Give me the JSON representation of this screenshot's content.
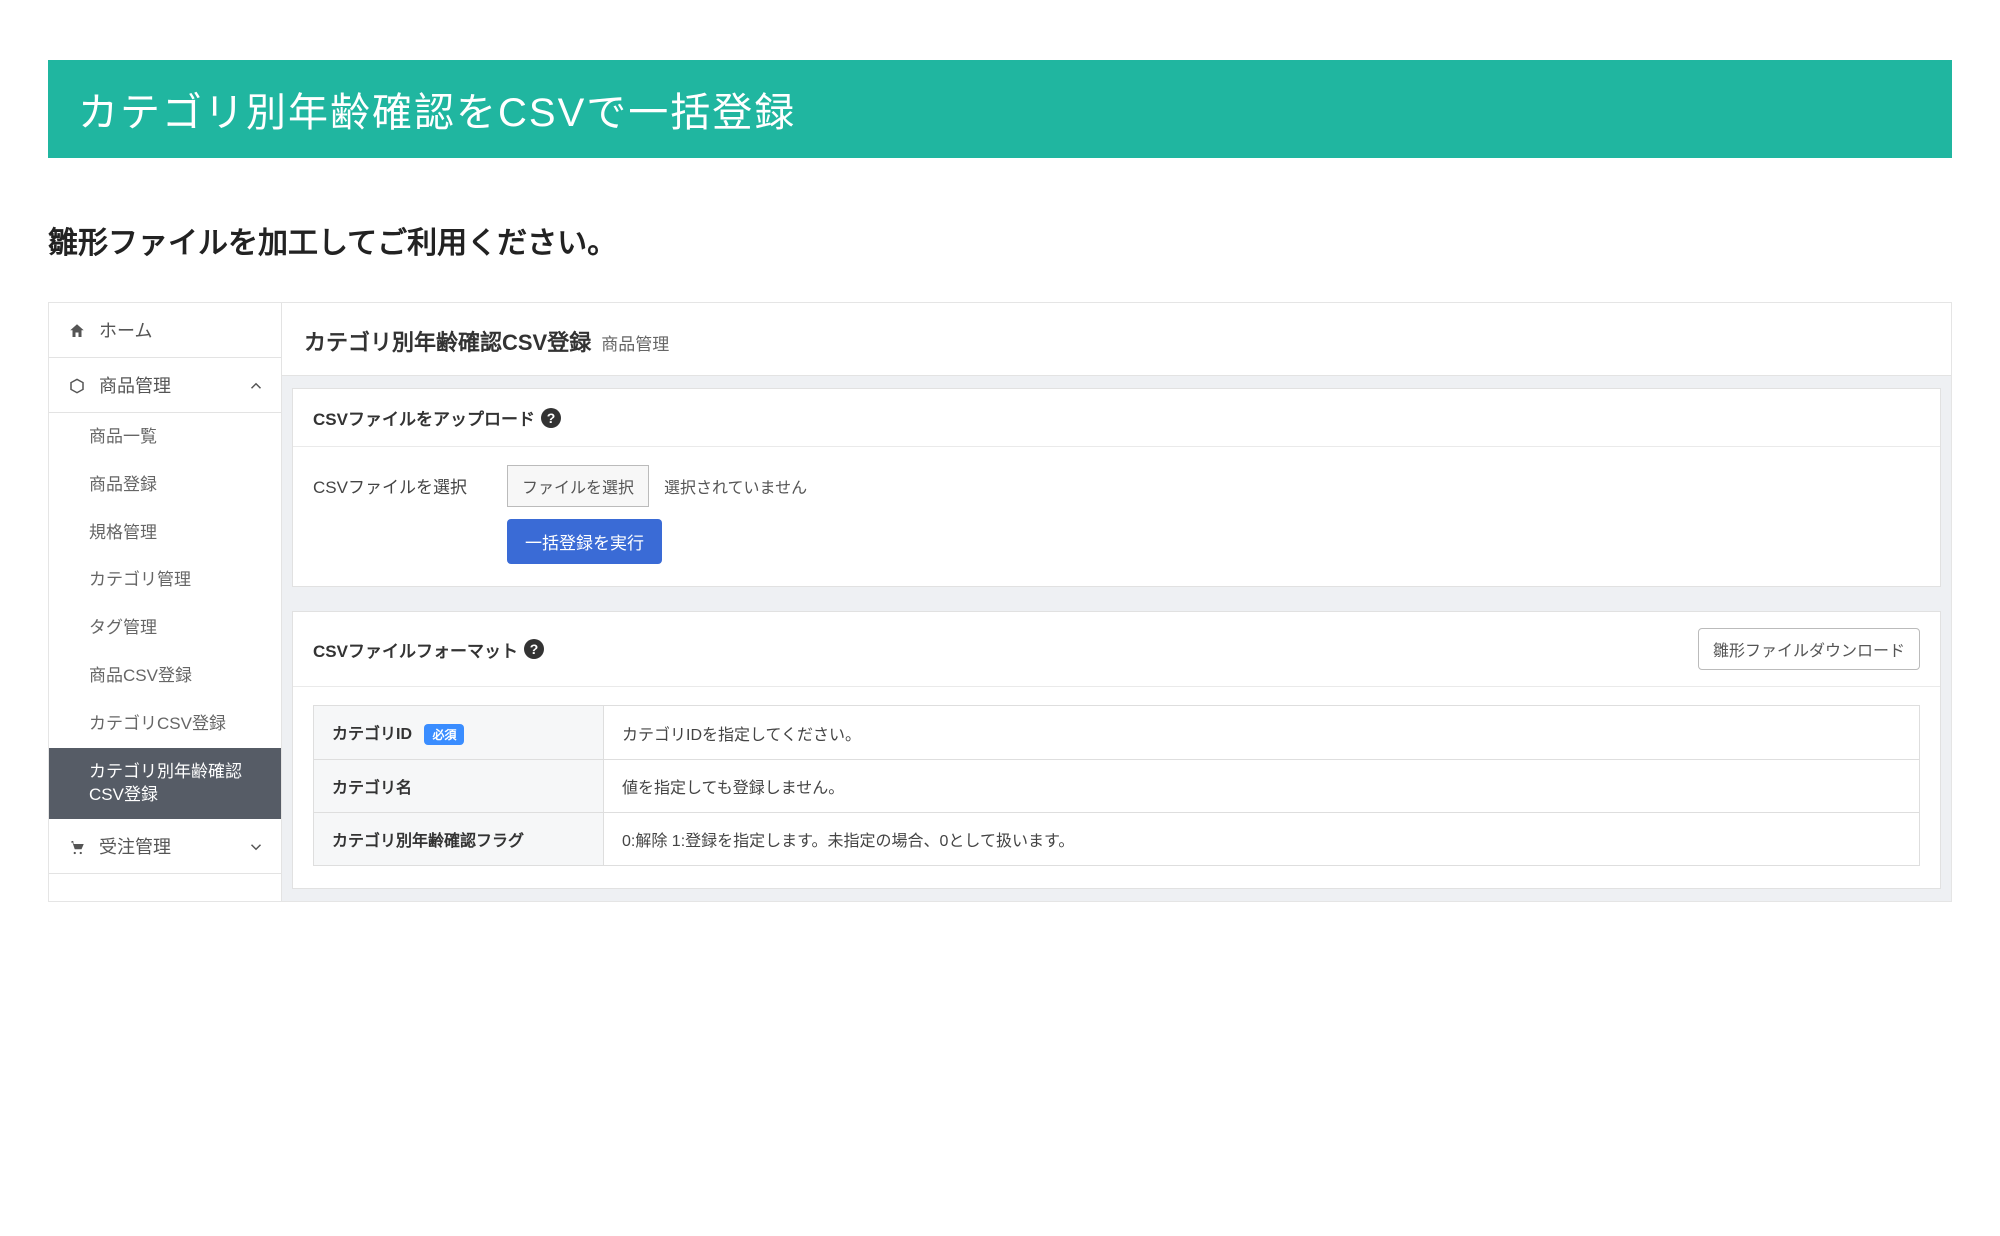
{
  "banner": {
    "title": "カテゴリ別年齢確認をCSVで一括登録"
  },
  "intro": "雛形ファイルを加工してご利用ください。",
  "sidebar": {
    "home": "ホーム",
    "product": "商品管理",
    "items": [
      "商品一覧",
      "商品登録",
      "規格管理",
      "カテゴリ管理",
      "タグ管理",
      "商品CSV登録",
      "カテゴリCSV登録",
      "カテゴリ別年齢確認CSV登録"
    ],
    "order": "受注管理"
  },
  "main": {
    "title": "カテゴリ別年齢確認CSV登録",
    "subtitle": "商品管理",
    "upload": {
      "heading": "CSVファイルをアップロード",
      "select_label": "CSVファイルを選択",
      "file_button": "ファイルを選択",
      "file_status": "選択されていません",
      "submit_button": "一括登録を実行"
    },
    "format": {
      "heading": "CSVファイルフォーマット",
      "download_button": "雛形ファイルダウンロード",
      "required_badge": "必須",
      "rows": [
        {
          "name": "カテゴリID",
          "required": true,
          "desc": "カテゴリIDを指定してください。"
        },
        {
          "name": "カテゴリ名",
          "required": false,
          "desc": "値を指定しても登録しません。"
        },
        {
          "name": "カテゴリ別年齢確認フラグ",
          "required": false,
          "desc": "0:解除 1:登録を指定します。未指定の場合、0として扱います。"
        }
      ]
    }
  }
}
